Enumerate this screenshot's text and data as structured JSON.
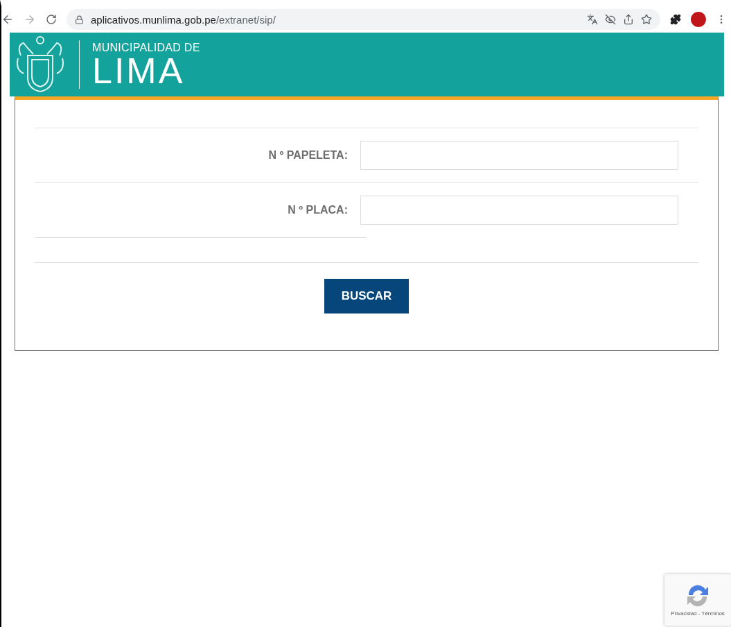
{
  "browser": {
    "url_host": "aplicativos.munlima.gob.pe",
    "url_path": "/extranet/sip/"
  },
  "header": {
    "subtitle": "MUNICIPALIDAD DE",
    "title": "LIMA"
  },
  "form": {
    "fields": [
      {
        "label": "N º PAPELETA:"
      },
      {
        "label": "N º PLACA:"
      }
    ],
    "button": "BUSCAR"
  },
  "recaptcha": {
    "links": "Privacidad - Términos"
  }
}
